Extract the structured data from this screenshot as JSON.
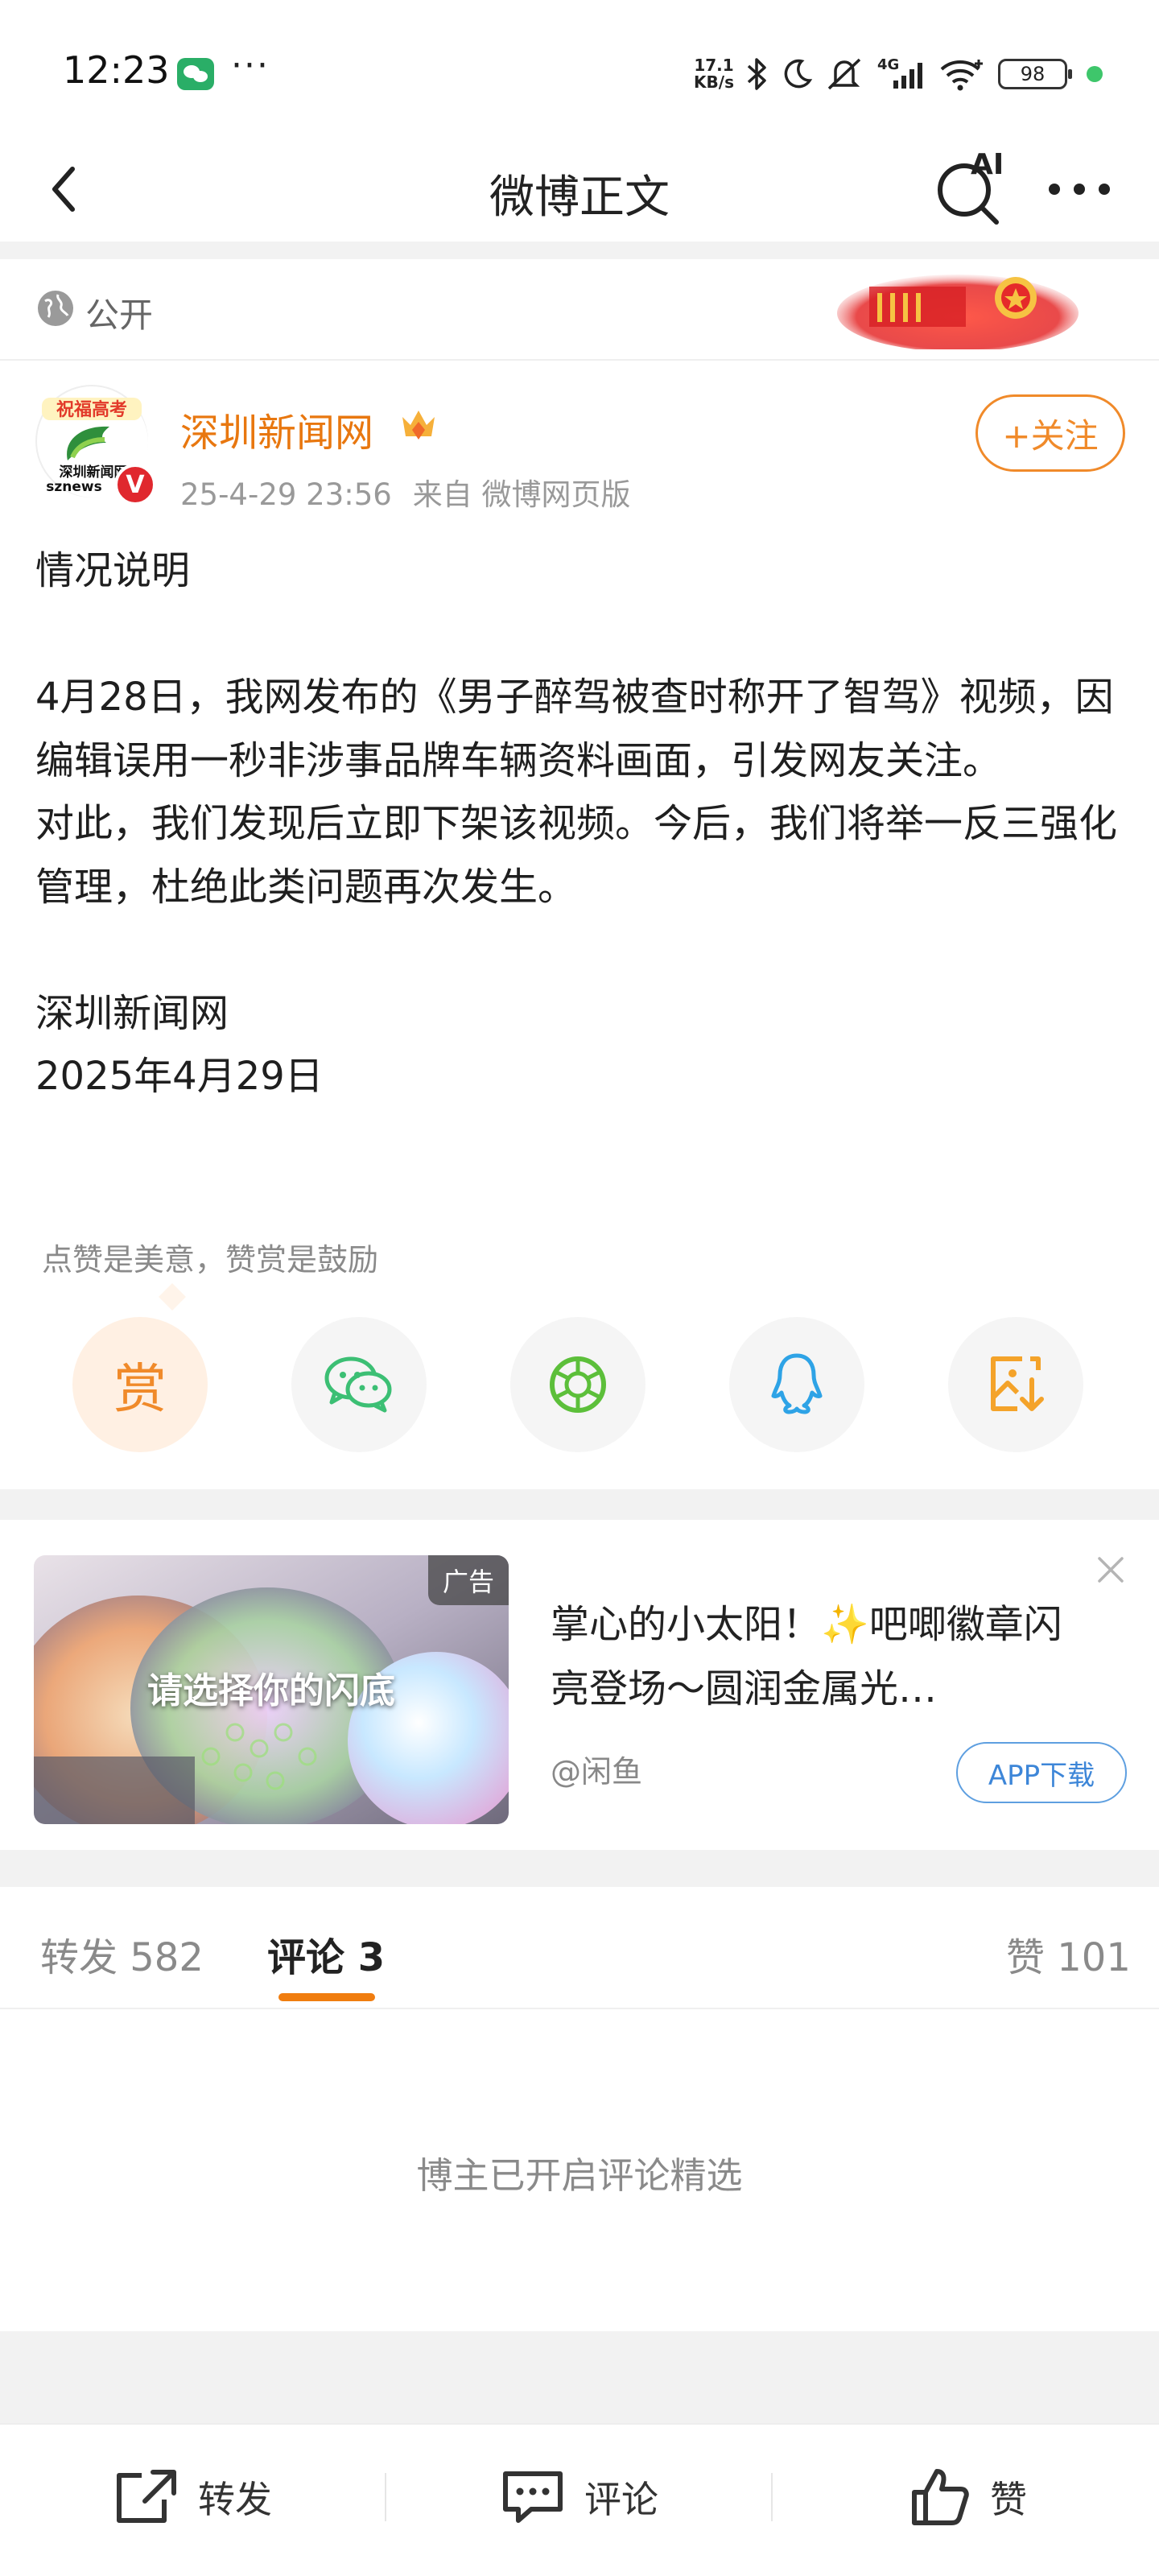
{
  "status_bar": {
    "time": "12:23",
    "overflow": "···",
    "speed_value": "17.1",
    "speed_unit": "KB/s",
    "network": "4G",
    "battery": "98",
    "icons": [
      "wechat-icon",
      "bluetooth-icon",
      "moon-icon",
      "mute-icon",
      "signal-icon",
      "wifi-icon",
      "battery-icon"
    ]
  },
  "nav": {
    "title": "微博正文",
    "ai_label": "AI"
  },
  "visibility": {
    "label": "公开"
  },
  "author": {
    "name": "深圳新闻网",
    "avatar_banner": "祝福高考",
    "avatar_caption": "深圳新闻网",
    "avatar_sub": "sznews",
    "verified_mark": "V",
    "date": "25-4-29 23:56",
    "source": "来自 微博网页版",
    "follow_label": "+关注"
  },
  "post": {
    "paragraphs": [
      "情况说明",
      "",
      "4月28日，我网发布的《男子醉驾被查时称开了智驾》视频，因编辑误用一秒非涉事品牌车辆资料画面，引发网友关注。",
      "对此，我们发现后立即下架该视频。今后，我们将举一反三强化管理，杜绝此类问题再次发生。",
      "",
      "深圳新闻网",
      "2025年4月29日"
    ]
  },
  "reward": {
    "hint": "点赞是美意，赞赏是鼓励",
    "reward_label": "赏",
    "share_targets": [
      "wechat-icon",
      "moments-icon",
      "qq-icon",
      "save-image-icon"
    ]
  },
  "ad": {
    "tag": "广告",
    "image_text": "请选择你的闪底",
    "title": "掌心的小太阳！✨吧唧徽章闪亮登场～圆润金属光…",
    "source": "@闲鱼",
    "button": "APP下载"
  },
  "tabs": {
    "repost": "转发 582",
    "comment": "评论 3",
    "like": "赞 101"
  },
  "comments": {
    "note": "博主已开启评论精选"
  },
  "bottom_bar": {
    "repost": "转发",
    "comment": "评论",
    "like": "赞"
  },
  "colors": {
    "accent_orange": "#e8770f",
    "tab_underline": "#f07d0f",
    "link_blue": "#3d86d8",
    "verified_red": "#e0282e"
  }
}
